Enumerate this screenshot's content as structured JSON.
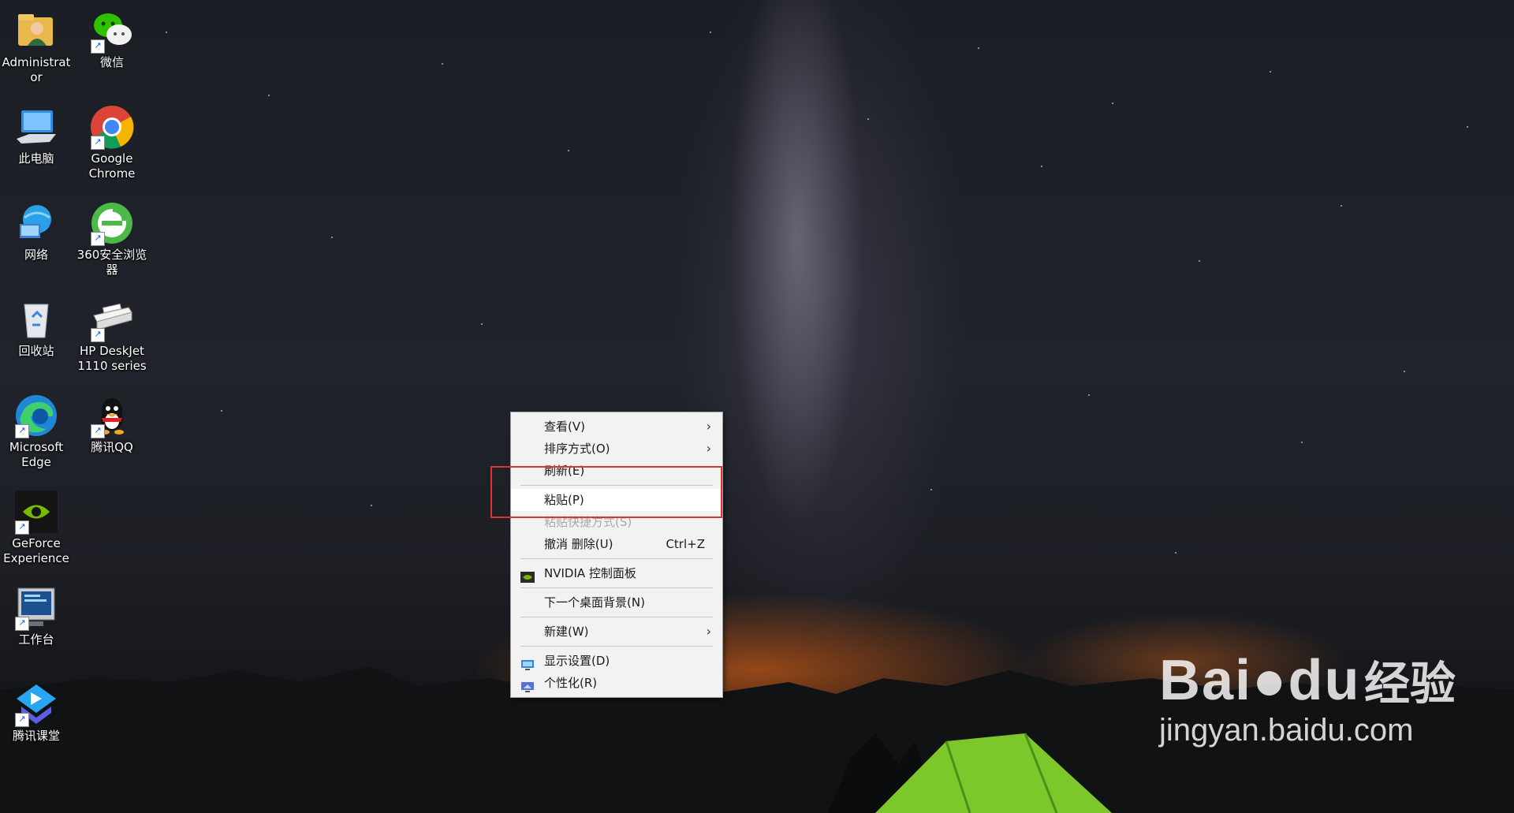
{
  "desktop": {
    "icons": [
      {
        "label": "Administrator",
        "icon": "user-folder-icon"
      },
      {
        "label": "微信",
        "icon": "wechat-icon"
      },
      {
        "label": "此电脑",
        "icon": "this-pc-icon"
      },
      {
        "label": "Google Chrome",
        "icon": "chrome-icon"
      },
      {
        "label": "网络",
        "icon": "network-icon"
      },
      {
        "label": "360安全浏览器",
        "icon": "browser-360-icon"
      },
      {
        "label": "回收站",
        "icon": "recycle-bin-icon"
      },
      {
        "label": "HP DeskJet 1110 series",
        "icon": "printer-icon"
      },
      {
        "label": "Microsoft Edge",
        "icon": "edge-icon"
      },
      {
        "label": "腾讯QQ",
        "icon": "qq-icon"
      },
      {
        "label": "GeForce Experience",
        "icon": "geforce-icon"
      },
      {
        "label": "工作台",
        "icon": "workbench-icon"
      },
      {
        "label": "腾讯课堂",
        "icon": "tencent-classroom-icon"
      }
    ]
  },
  "context_menu": {
    "items": [
      {
        "label": "查看(V)",
        "has_submenu": true
      },
      {
        "label": "排序方式(O)",
        "has_submenu": true
      },
      {
        "label": "刷新(E)"
      },
      {
        "label": "粘贴(P)",
        "highlighted": true
      },
      {
        "label": "粘贴快捷方式(S)",
        "disabled": true
      },
      {
        "label": "撤消 删除(U)",
        "shortcut": "Ctrl+Z"
      },
      {
        "label": "NVIDIA 控制面板",
        "icon": "nvidia-icon"
      },
      {
        "label": "下一个桌面背景(N)"
      },
      {
        "label": "新建(W)",
        "has_submenu": true
      },
      {
        "label": "显示设置(D)",
        "icon": "display-icon"
      },
      {
        "label": "个性化(R)",
        "icon": "personalize-icon"
      }
    ]
  },
  "watermark": {
    "brand": "Bai",
    "brand_suffix": "du",
    "brand_cn": "经验",
    "url": "jingyan.baidu.com"
  },
  "colors": {
    "highlight_border": "#e0332e",
    "menu_background": "#f2f2f2"
  }
}
